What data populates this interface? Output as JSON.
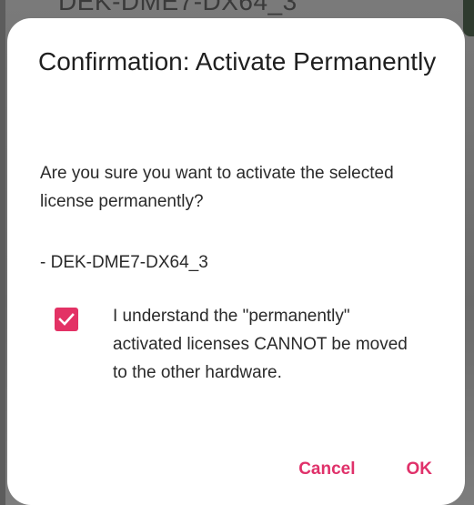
{
  "background": {
    "partial_text": "DEK-DME7-DX64_3"
  },
  "dialog": {
    "title": "Confirmation: Activate Permanently",
    "message": "Are you sure you want to activate the selected license permanently?",
    "license_item": "- DEK-DME7-DX64_3",
    "acknowledgement": {
      "checked": true,
      "text": "I understand the \"permanently\" activated licenses CANNOT be moved to the other hardware."
    },
    "buttons": {
      "cancel_label": "Cancel",
      "ok_label": "OK"
    }
  },
  "colors": {
    "accent": "#e0316a",
    "checkbox": "#e33265",
    "dialog_bg": "#ffffff",
    "scrim": "#6f6f6f"
  },
  "icons": {
    "checkbox": "check-icon"
  }
}
